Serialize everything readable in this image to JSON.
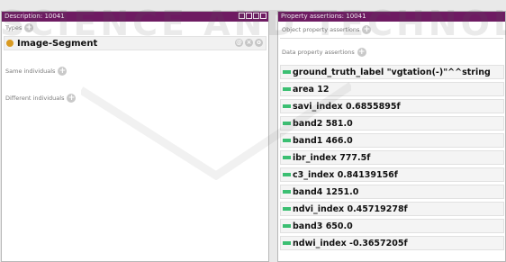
{
  "left_panel": {
    "title": "Description: 10041",
    "types_label": "Types",
    "type_item": "Image-Segment",
    "same_label": "Same individuals",
    "different_label": "Different individuals"
  },
  "right_panel": {
    "title": "Property assertions: 10041",
    "object_label": "Object property assertions",
    "data_label": "Data property assertions",
    "assertions": [
      "ground_truth_label  \"vgtation(-)\"^^string",
      "area  12",
      "savi_index  0.6855895f",
      "band2  581.0",
      "band1  466.0",
      "ibr_index  777.5f",
      "c3_index  0.84139156f",
      "band4  1251.0",
      "ndvi_index  0.45719278f",
      "band3  650.0",
      "ndwi_index  -0.3657205f"
    ]
  },
  "colors": {
    "titlebar": "#6e1b62",
    "type_dot": "#d99a21",
    "assertion_bar": "#3bbf72"
  },
  "watermark": {
    "text": "SCIENCE AND TECHNOLOGY PUBLICATIONS"
  },
  "icons": [
    "add-icon",
    "info-icon",
    "delete-icon",
    "edit-icon",
    "data-property-icon"
  ]
}
